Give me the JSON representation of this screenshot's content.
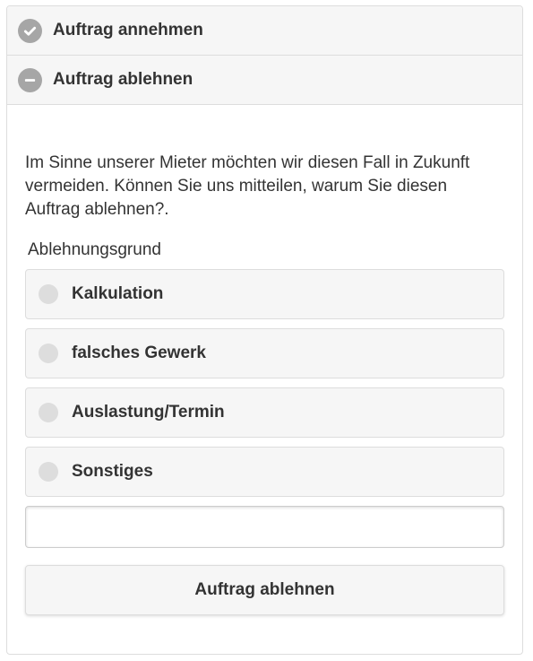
{
  "accordion": {
    "accept": {
      "label": "Auftrag annehmen",
      "icon": "check-icon"
    },
    "decline": {
      "label": "Auftrag ablehnen",
      "icon": "minus-icon"
    }
  },
  "form": {
    "intro": "Im Sinne unserer Mieter möchten wir diesen Fall in Zukunft vermeiden. Können Sie uns mitteilen, warum Sie diesen Auftrag ablehnen?.",
    "reason_label": "Ablehnungsgrund",
    "options": [
      {
        "label": "Kalkulation"
      },
      {
        "label": "falsches Gewerk"
      },
      {
        "label": "Auslastung/Termin"
      },
      {
        "label": "Sonstiges"
      }
    ],
    "other_input_value": "",
    "submit_label": "Auftrag ablehnen"
  },
  "colors": {
    "header_bg": "#f6f6f6",
    "icon_bg": "#a6a6a6",
    "border": "#dddddd",
    "text": "#333333"
  }
}
